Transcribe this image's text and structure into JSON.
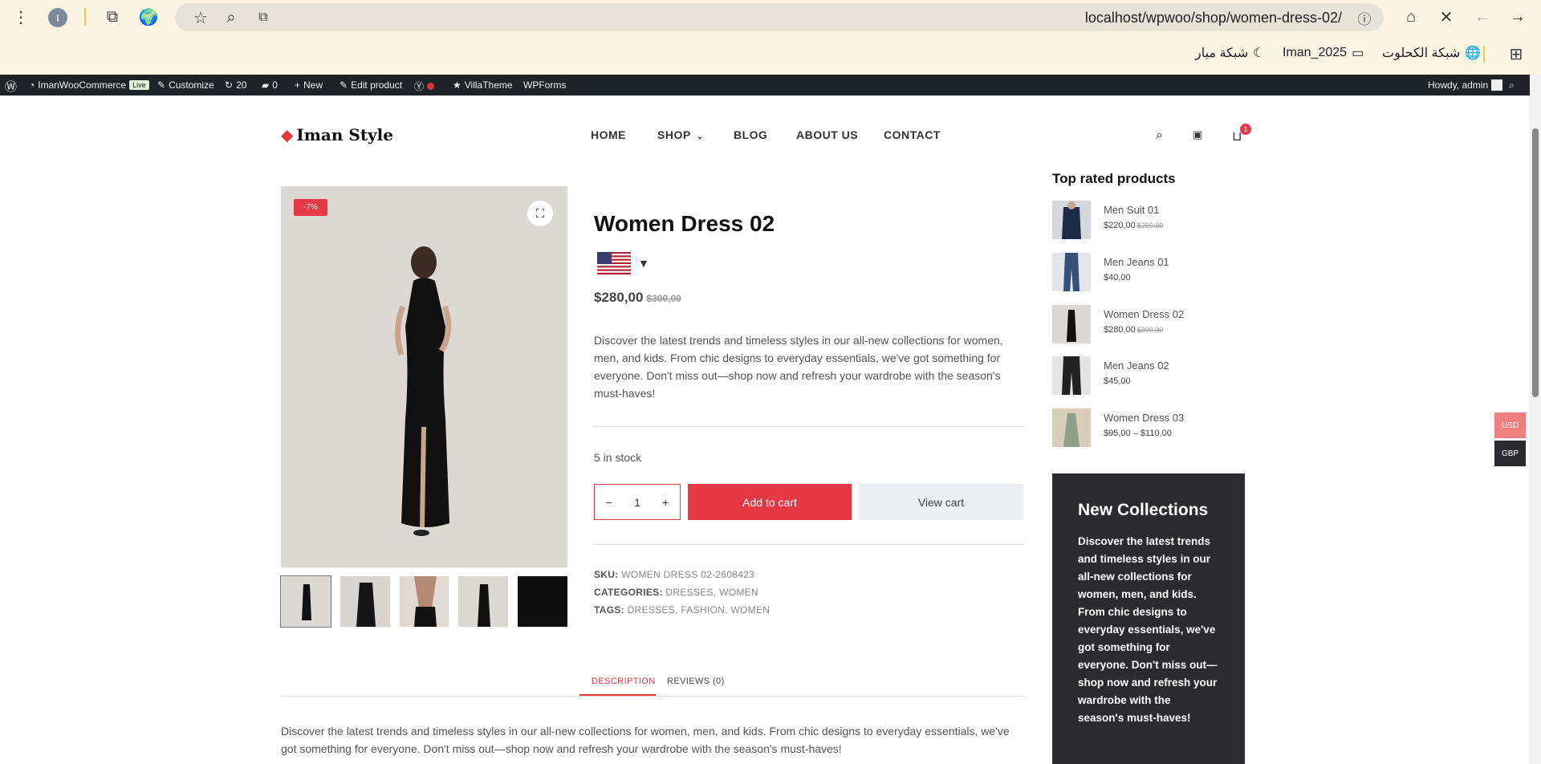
{
  "browser": {
    "url": "localhost/wpwoo/shop/women-dress-02/",
    "profile_initial": "I",
    "bookmarks": [
      "شبكة الكحلوت",
      "Iman_2025",
      "شبكة ميار"
    ]
  },
  "adminbar": {
    "site_name": "ImanWooCommerce",
    "live": "Live",
    "customize": "Customize",
    "updates": "20",
    "comments": "0",
    "new": "New",
    "edit_product": "Edit product",
    "villatheme": "VillaTheme",
    "wpforms": "WPForms",
    "howdy": "Howdy, admin"
  },
  "site": {
    "logo": "Iman Style",
    "nav": [
      "HOME",
      "SHOP",
      "BLOG",
      "ABOUT US",
      "CONTACT"
    ],
    "cart_count": "1"
  },
  "product": {
    "sale_badge": "-7%",
    "title": "Women Dress 02",
    "price": "$280,00",
    "regular_price": "$300,00",
    "description": "Discover the latest trends and timeless styles in our all-new collections for women, men, and kids. From chic designs to everyday essentials, we've got something for everyone. Don't miss out—shop now and refresh your wardrobe with the season's must-haves!",
    "stock": "5 in stock",
    "quantity": "1",
    "add_to_cart": "Add to cart",
    "view_cart": "View cart",
    "sku_label": "SKU:",
    "sku": "WOMEN DRESS 02-2608423",
    "categories_label": "CATEGORIES:",
    "categories": [
      "DRESSES",
      "WOMEN"
    ],
    "tags_label": "TAGS:",
    "tags": [
      "DRESSES",
      "FASHION",
      "WOMEN"
    ]
  },
  "tabs": {
    "description": "DESCRIPTION",
    "reviews": "REVIEWS (0)",
    "content": "Discover the latest trends and timeless styles in our all-new collections for women, men, and kids. From chic designs to everyday essentials, we've got something for everyone. Don't miss out—shop now and refresh your wardrobe with the season's must-haves!"
  },
  "sidebar": {
    "title": "Top rated products",
    "items": [
      {
        "name": "Men Suit 01",
        "price": "$220,00",
        "old": "$250,00"
      },
      {
        "name": "Men Jeans 01",
        "price": "$40,00",
        "old": ""
      },
      {
        "name": "Women Dress 02",
        "price": "$280,00",
        "old": "$300,00"
      },
      {
        "name": "Men Jeans 02",
        "price": "$45,00",
        "old": ""
      },
      {
        "name": "Women Dress 03",
        "price": "$95,00 – $110,00",
        "old": ""
      }
    ],
    "promo_title": "New Collections",
    "promo_text": "Discover the latest trends and timeless styles in our all-new collections for women, men, and kids. From chic designs to everyday essentials, we've got something for everyone. Don't miss out—shop now and refresh your wardrobe with the season's must-haves!"
  },
  "currency": {
    "usd": "USD",
    "gbp": "GBP"
  }
}
